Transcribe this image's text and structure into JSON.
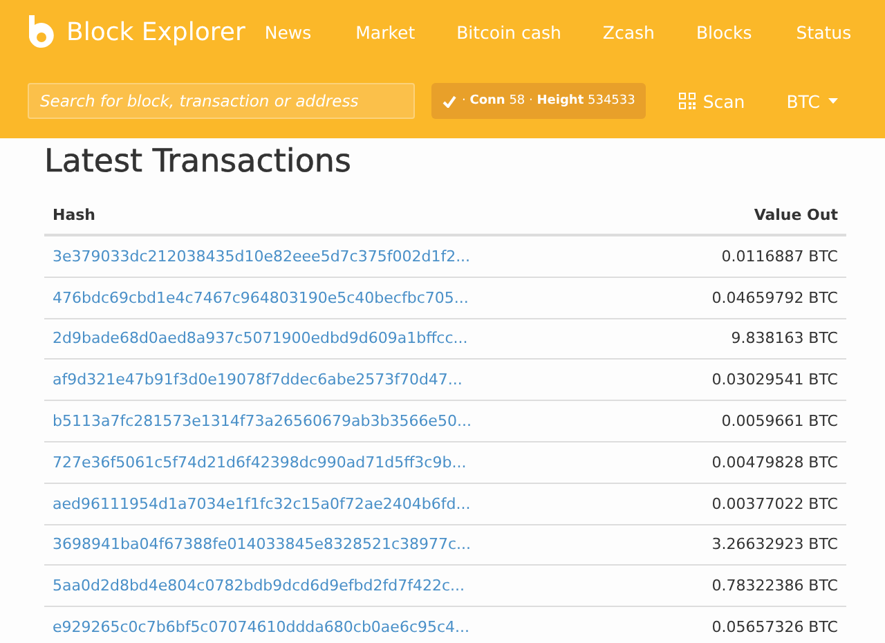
{
  "header": {
    "brand": "Block Explorer",
    "nav": [
      "News",
      "Market",
      "Bitcoin cash",
      "Zcash",
      "Blocks",
      "Status"
    ],
    "search": {
      "placeholder": "Search for block, transaction or address"
    },
    "status": "· **Conn** 58 · **Height** 534533",
    "scan": "Scan",
    "currency": "BTC"
  },
  "title": "Latest Transactions",
  "table": {
    "columns": [
      "Hash",
      "Value Out"
    ],
    "rows": [
      {
        "hash": "3e379033dc212038435d10e82eee5d7c375f002d1f2...",
        "value": "0.0116887 BTC"
      },
      {
        "hash": "476bdc69cbd1e4c7467c964803190e5c40becfbc705...",
        "value": "0.04659792 BTC"
      },
      {
        "hash": "2d9bade68d0aed8a937c5071900edbd9d609a1bffcc...",
        "value": "9.838163 BTC"
      },
      {
        "hash": "af9d321e47b91f3d0e19078f7ddec6abe2573f70d47...",
        "value": "0.03029541 BTC"
      },
      {
        "hash": "b5113a7fc281573e1314f73a26560679ab3b3566e50...",
        "value": "0.0059661 BTC"
      },
      {
        "hash": "727e36f5061c5f74d21d6f42398dc990ad71d5ff3c9b...",
        "value": "0.00479828 BTC"
      },
      {
        "hash": "aed96111954d1a7034e1f1fc32c15a0f72ae2404b6fd...",
        "value": "0.00377022 BTC"
      },
      {
        "hash": "3698941ba04f67388fe014033845e8328521c38977c...",
        "value": "3.26632923 BTC"
      },
      {
        "hash": "5aa0d2d8bd4e804c0782bdb9dcd6d9efbd2fd7f422c...",
        "value": "0.78322386 BTC"
      },
      {
        "hash": "e929265c0c7b6bf5c07074610ddda680cb0ae6c95c4...",
        "value": "0.05657326 BTC"
      }
    ]
  }
}
